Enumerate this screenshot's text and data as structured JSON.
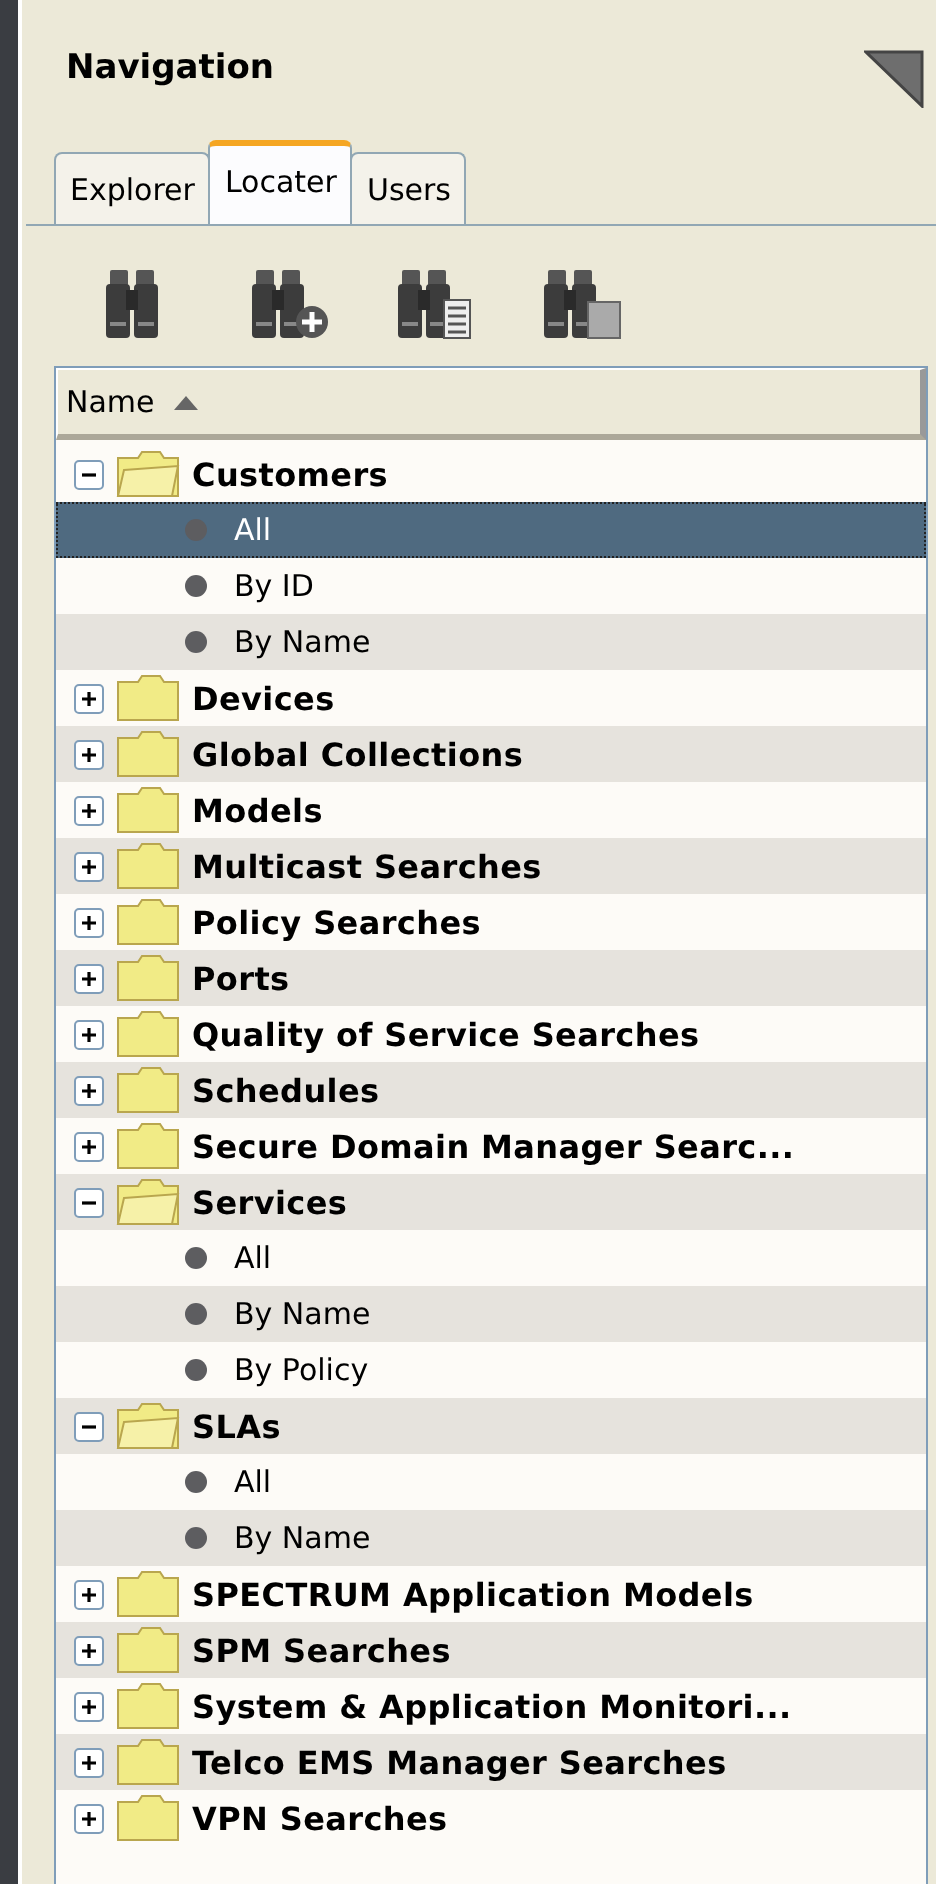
{
  "panel": {
    "title": "Navigation"
  },
  "tabs": [
    {
      "label": "Explorer",
      "selected": false
    },
    {
      "label": "Locater",
      "selected": true
    },
    {
      "label": "Users",
      "selected": false
    }
  ],
  "toolbar": [
    {
      "kind": "find"
    },
    {
      "kind": "add"
    },
    {
      "kind": "list"
    },
    {
      "kind": "folder"
    }
  ],
  "table": {
    "columns": [
      {
        "label": "Name",
        "sort_ascending": true
      }
    ]
  },
  "tree": [
    {
      "label": "Customers",
      "expanded": true,
      "selected": false,
      "children": [
        {
          "label": "All",
          "selected": true
        },
        {
          "label": "By ID",
          "selected": false
        },
        {
          "label": "By Name",
          "selected": false
        }
      ]
    },
    {
      "label": "Devices",
      "expanded": false,
      "selected": false
    },
    {
      "label": "Global Collections",
      "expanded": false,
      "selected": false
    },
    {
      "label": "Models",
      "expanded": false,
      "selected": false
    },
    {
      "label": "Multicast Searches",
      "expanded": false,
      "selected": false
    },
    {
      "label": "Policy Searches",
      "expanded": false,
      "selected": false
    },
    {
      "label": "Ports",
      "expanded": false,
      "selected": false
    },
    {
      "label": "Quality of Service Searches",
      "expanded": false,
      "selected": false
    },
    {
      "label": "Schedules",
      "expanded": false,
      "selected": false
    },
    {
      "label": "Secure Domain Manager Searc...",
      "expanded": false,
      "selected": false
    },
    {
      "label": "Services",
      "expanded": true,
      "selected": false,
      "children": [
        {
          "label": "All",
          "selected": false
        },
        {
          "label": "By Name",
          "selected": false
        },
        {
          "label": "By Policy",
          "selected": false
        }
      ]
    },
    {
      "label": "SLAs",
      "expanded": true,
      "selected": false,
      "children": [
        {
          "label": "All",
          "selected": false
        },
        {
          "label": "By Name",
          "selected": false
        }
      ]
    },
    {
      "label": "SPECTRUM Application Models",
      "expanded": false,
      "selected": false
    },
    {
      "label": "SPM Searches",
      "expanded": false,
      "selected": false
    },
    {
      "label": "System & Application Monitori...",
      "expanded": false,
      "selected": false
    },
    {
      "label": "Telco EMS Manager Searches",
      "expanded": false,
      "selected": false
    },
    {
      "label": "VPN Searches",
      "expanded": false,
      "selected": false
    }
  ]
}
